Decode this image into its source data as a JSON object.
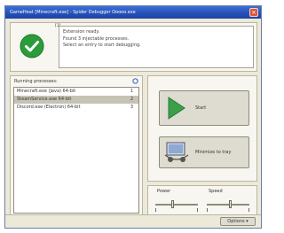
{
  "window": {
    "title": "GameHeat [Minecraft.exe] - Spider Debugger Ooooo.exe",
    "close_glyph": "✕"
  },
  "status": {
    "caption": "[1]",
    "lines": [
      "Extension ready.",
      "Found 3 injectable processes.",
      "Select an entry to start debugging."
    ]
  },
  "process_list": {
    "header": "Running processes:",
    "items": [
      {
        "name": "Minecraft.exe (Java) 64-bit",
        "num": "1"
      },
      {
        "name": "SteamService.exe 64-bit",
        "num": "2"
      },
      {
        "name": "Discord.exe (Electron) 64-bit",
        "num": "3"
      }
    ],
    "selected_index": 1
  },
  "actions": {
    "start_label": "Start",
    "tray_label": "Minimize to tray"
  },
  "sliders": {
    "left_label": "Power",
    "left_value": 0.4,
    "right_label": "Speed",
    "right_value": 0.55
  },
  "footer": {
    "options_label": "Options ▾"
  },
  "colors": {
    "title_bar": "#2451b8",
    "success_green": "#2a9d3a",
    "play_green": "#3aa04a"
  }
}
